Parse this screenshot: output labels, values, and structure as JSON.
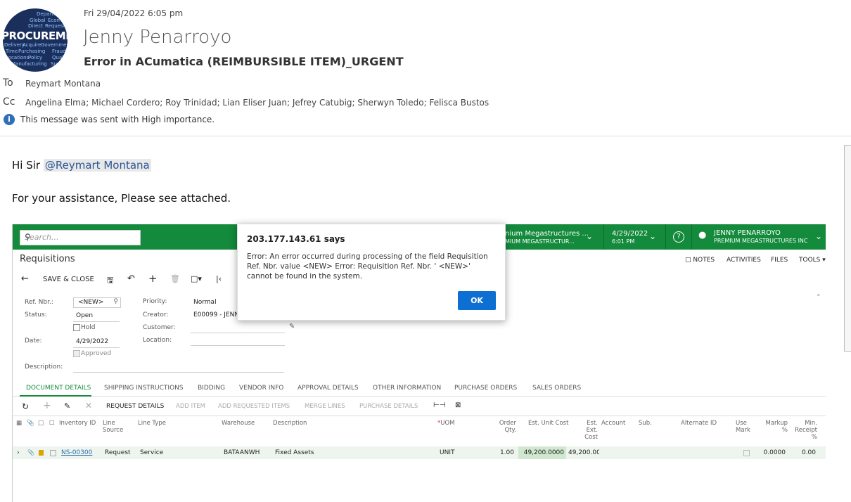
{
  "email": {
    "avatar_words": [
      "Department",
      "Global",
      "Econ",
      "Direct",
      "Request",
      "Delivery",
      "Acquire",
      "Government",
      "Time",
      "Purchasing",
      "Fraud",
      "Locations",
      "Policy",
      "Quality",
      "Manufacturing",
      "Supply"
    ],
    "avatar_big": "PROCUREMENT",
    "sent": "Fri 29/04/2022 6:05 pm",
    "sender": "Jenny Penarroyo",
    "subject": "Error in ACumatica (REIMBURSIBLE ITEM)_URGENT",
    "to_label": "To",
    "to": "Reymart Montana",
    "cc_label": "Cc",
    "cc": "Angelina Elma; Michael Cordero; Roy Trinidad; Lian Eliser Juan; Jefrey Catubig; Sherwyn Toledo; Felisca Bustos",
    "importance": "This message was sent with High importance.",
    "greeting": "Hi Sir",
    "mention": "@Reymart Montana",
    "body": "For your assistance, Please see attached."
  },
  "app": {
    "search_placeholder": "Search...",
    "company_line1": "nium Megastructures ...",
    "company_line2": "MIUM MEGASTRUCTUR...",
    "date_line1": "4/29/2022",
    "date_line2": "6:01 PM",
    "user_line1": "JENNY PENARROYO",
    "user_line2": "PREMIUM MEGASTRUCTURES INC",
    "page_title": "Requisitions",
    "save_close": "SAVE & CLOSE",
    "notes": "NOTES",
    "activities": "ACTIVITIES",
    "files": "FILES",
    "tools": "TOOLS",
    "form": {
      "ref_label": "Ref. Nbr.:",
      "ref_value": "<NEW>",
      "status_label": "Status:",
      "status_value": "Open",
      "hold_label": "Hold",
      "date_label": "Date:",
      "date_value": "4/29/2022",
      "approved_label": "Approved",
      "description_label": "Description:",
      "priority_label": "Priority:",
      "priority_value": "Normal",
      "creator_label": "Creator:",
      "creator_value": "E00099 - JENNY",
      "customer_label": "Customer:",
      "location_label": "Location:"
    },
    "tabs": [
      "DOCUMENT DETAILS",
      "SHIPPING INSTRUCTIONS",
      "BIDDING",
      "VENDOR INFO",
      "APPROVAL DETAILS",
      "OTHER INFORMATION",
      "PURCHASE ORDERS",
      "SALES ORDERS"
    ],
    "grid_toolbar": {
      "request_details": "REQUEST DETAILS",
      "add_item": "ADD ITEM",
      "add_requested": "ADD REQUESTED ITEMS",
      "merge_lines": "MERGE LINES",
      "purchase_details": "PURCHASE DETAILS"
    },
    "columns": {
      "inventory": "Inventory ID",
      "line_source": "Line Source",
      "line_type": "Line Type",
      "warehouse": "Warehouse",
      "description": "Description",
      "uom": "UOM",
      "order_qty": "Order Qty.",
      "unit_cost": "Est. Unit Cost",
      "ext_cost": "Est. Ext. Cost",
      "account": "Account",
      "sub": "Sub.",
      "alt_id": "Alternate ID",
      "use_mark": "Use Mark",
      "markup": "Markup %",
      "min_receipt": "Min. Receipt %"
    },
    "row": {
      "inventory": "NS-00300",
      "line_source": "Request",
      "line_type": "Service",
      "warehouse": "BATAANWH",
      "description": "Fixed Assets",
      "uom": "UNIT",
      "order_qty": "1.00",
      "unit_cost": "49,200.0000",
      "ext_cost": "49,200.00",
      "markup": "0.0000",
      "min_receipt": "0.00"
    }
  },
  "dialog": {
    "title": "203.177.143.61 says",
    "message": "Error: An error occurred during processing of the field Requisition Ref. Nbr. value  <NEW>          Error: Requisition Ref. Nbr. ' <NEW>' cannot be found in the system.",
    "ok": "OK"
  }
}
